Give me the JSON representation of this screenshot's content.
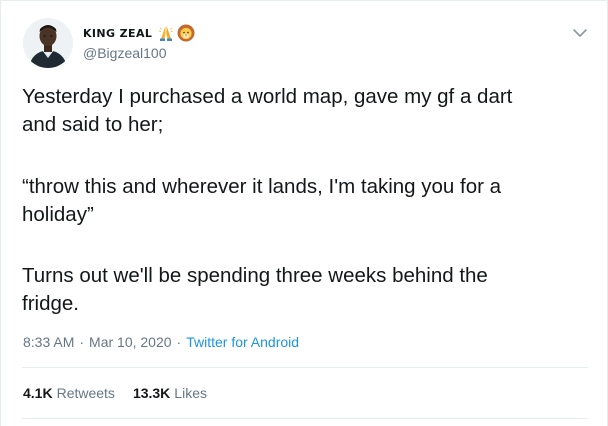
{
  "user": {
    "display_name": "KING ZEAL",
    "emoji_1": "folded-hands-icon",
    "emoji_2": "lion-face-icon",
    "handle": "@Bigzeal100"
  },
  "tweet": {
    "paragraphs": [
      "Yesterday I purchased a world map, gave my gf a dart\nand said to her;",
      "“throw this and wherever it lands, I'm taking you for a\nholiday”",
      "Turns out we'll be spending three weeks behind the\nfridge."
    ],
    "time": "8:33 AM",
    "separator": "·",
    "date": "Mar 10, 2020",
    "source": "Twitter for Android"
  },
  "stats": {
    "retweets_count": "4.1K",
    "retweets_label": "Retweets",
    "likes_count": "13.3K",
    "likes_label": "Likes"
  },
  "colors": {
    "text": "#14171a",
    "secondary": "#657786",
    "link": "#1b95e0",
    "divider": "#e6ecf0"
  }
}
